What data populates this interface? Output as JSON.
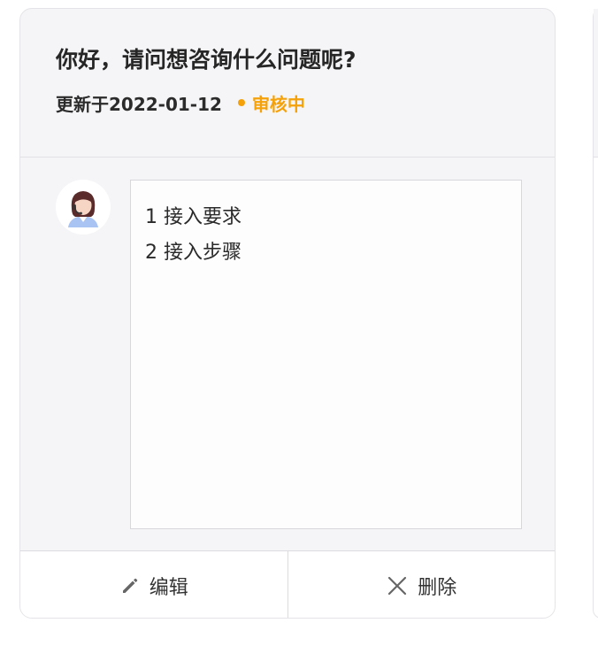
{
  "question": {
    "title": "你好，请问想咨询什么问题呢?",
    "updated": "更新于2022-01-12",
    "status": {
      "label": "审核中",
      "color": "#f5a20a"
    }
  },
  "reply": {
    "avatar_icon": "female-agent-avatar-icon",
    "lines": [
      "1 接入要求",
      "2 接入步骤"
    ]
  },
  "actions": {
    "edit": {
      "label": "编辑",
      "icon": "pencil-icon"
    },
    "delete": {
      "label": "删除",
      "icon": "close-icon"
    }
  }
}
